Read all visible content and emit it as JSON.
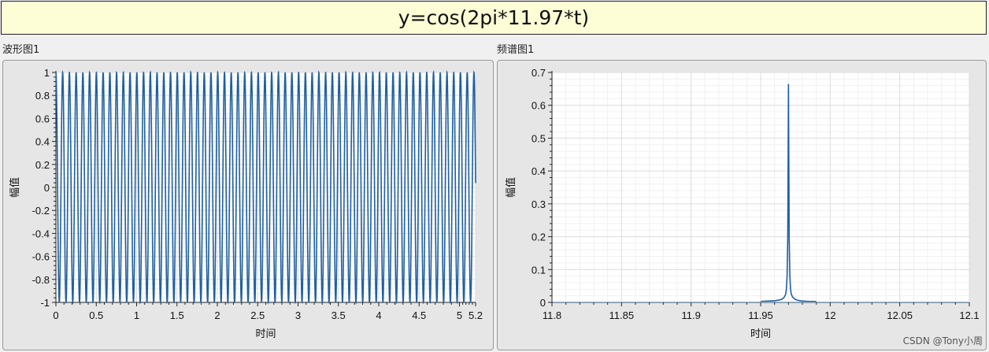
{
  "title": "y=cos(2pi*11.97*t)",
  "watermark": "CSDN @Tony小周",
  "panels": [
    {
      "label": "波形图1"
    },
    {
      "label": "频谱图1"
    }
  ],
  "chart_data": [
    {
      "type": "line",
      "name": "波形图1",
      "title": "",
      "xlabel": "时间",
      "ylabel": "幅值",
      "xlim": [
        0,
        5.2
      ],
      "ylim": [
        -1,
        1
      ],
      "xticks": [
        "0",
        "0.5",
        "1",
        "1.5",
        "2",
        "2.5",
        "3",
        "3.5",
        "4",
        "4.5",
        "5",
        "5.2"
      ],
      "yticks": [
        "1",
        "0.8",
        "0.6",
        "0.4",
        "0.2",
        "0",
        "-0.2",
        "-0.4",
        "-0.6",
        "-0.8",
        "-1"
      ],
      "grid": true,
      "series": [
        {
          "function": "cos(2*pi*11.97*t)",
          "frequency": 11.97,
          "amplitude": 1,
          "x_start": 0,
          "x_end": 5.2,
          "color": "#1f5fa0"
        }
      ]
    },
    {
      "type": "line",
      "name": "频谱图1",
      "title": "",
      "xlabel": "时间",
      "ylabel": "幅值",
      "xlim": [
        11.8,
        12.1
      ],
      "ylim": [
        0,
        0.7
      ],
      "xticks": [
        "11.8",
        "11.85",
        "11.9",
        "11.95",
        "12",
        "12.05",
        "12.1"
      ],
      "yticks": [
        "0.7",
        "0.6",
        "0.5",
        "0.4",
        "0.3",
        "0.2",
        "0.1",
        "0"
      ],
      "grid": true,
      "series": [
        {
          "color": "#1f5fa0",
          "x": [
            11.95,
            11.955,
            11.96,
            11.963,
            11.965,
            11.966,
            11.967,
            11.968,
            11.9685,
            11.969,
            11.9695,
            11.97,
            11.9705,
            11.971,
            11.9715,
            11.972,
            11.973,
            11.974,
            11.975,
            11.977,
            11.98,
            11.985,
            11.99
          ],
          "y": [
            0.003,
            0.004,
            0.005,
            0.007,
            0.009,
            0.012,
            0.016,
            0.025,
            0.04,
            0.08,
            0.2,
            0.665,
            0.2,
            0.08,
            0.04,
            0.025,
            0.016,
            0.012,
            0.009,
            0.006,
            0.004,
            0.003,
            0.003
          ]
        }
      ]
    }
  ]
}
